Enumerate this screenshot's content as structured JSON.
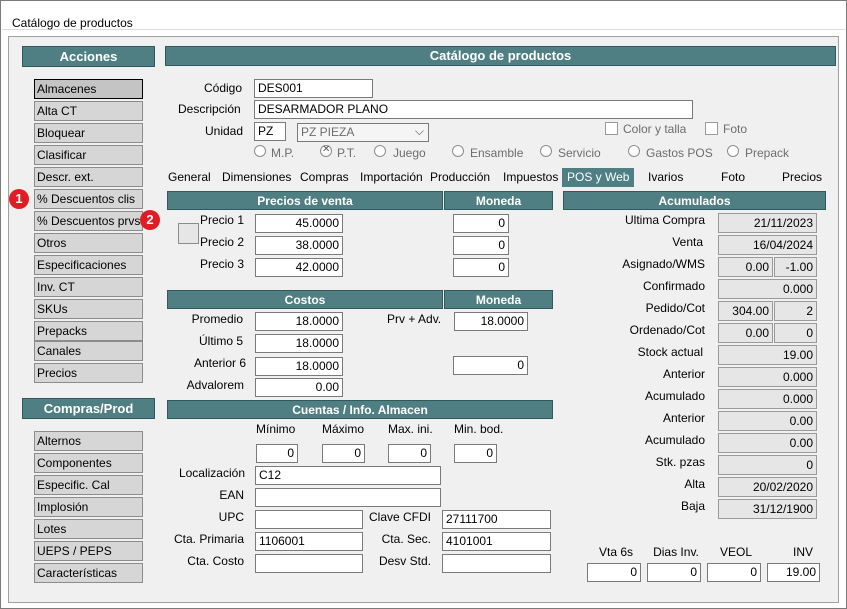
{
  "window": {
    "title": "Catálogo de productos"
  },
  "sidebar": {
    "acciones_title": "Acciones",
    "acciones": [
      "Almacenes",
      "Alta CT",
      "Bloquear",
      "Clasificar",
      "Descr. ext.",
      "% Descuentos clis",
      "% Descuentos prvs",
      "Otros",
      "Especificaciones",
      "Inv. CT",
      "SKUs",
      "Prepacks",
      "Canales",
      "Precios"
    ],
    "compras_title": "Compras/Prod",
    "compras": [
      "Alternos",
      "Componentes",
      "Especific. Cal",
      "Implosión",
      "Lotes",
      "UEPS / PEPS",
      "Características"
    ],
    "badges": [
      "1",
      "2"
    ]
  },
  "main": {
    "title": "Catálogo de productos",
    "codigo_label": "Código",
    "codigo": "DES001",
    "descripcion_label": "Descripción",
    "descripcion": "DESARMADOR PLANO",
    "unidad_label": "Unidad",
    "unidad": "PZ",
    "unidad_select": "PZ  PIEZA",
    "color_talla": "Color y talla",
    "foto": "Foto",
    "radios": [
      "M.P.",
      "P.T.",
      "Juego",
      "Ensamble",
      "Servicio",
      "Gastos POS",
      "Prepack"
    ],
    "radio_selected": "P.T."
  },
  "tabs": [
    "General",
    "Dimensiones",
    "Compras",
    "Importación",
    "Producción",
    "Impuestos",
    "POS y Web",
    "Ivarios",
    "Foto",
    "Precios"
  ],
  "active_tab": "POS y Web",
  "precios": {
    "title": "Precios de venta",
    "moneda": "Moneda",
    "rows": [
      {
        "label": "Precio 1",
        "value": "45.0000",
        "moneda": "0"
      },
      {
        "label": "Precio 2",
        "value": "38.0000",
        "moneda": "0"
      },
      {
        "label": "Precio 3",
        "value": "42.0000",
        "moneda": "0"
      }
    ]
  },
  "costos": {
    "title": "Costos",
    "moneda": "Moneda",
    "promedio_label": "Promedio",
    "promedio": "18.0000",
    "ultimo_label": "Último 5",
    "ultimo": "18.0000",
    "anterior_label": "Anterior 6",
    "anterior": "18.0000",
    "advalorem_label": "Advalorem",
    "advalorem": "0.00",
    "prv_label": "Prv + Adv.",
    "prv": "18.0000",
    "moneda_value": "0"
  },
  "cuentas": {
    "title": "Cuentas / Info. Almacen",
    "minimo_label": "Mínimo",
    "minimo": "0",
    "maximo_label": "Máximo",
    "maximo": "0",
    "maxini_label": "Max. ini.",
    "maxini": "0",
    "minbod_label": "Min. bod.",
    "minbod": "0",
    "localizacion_label": "Localización",
    "localizacion": "C12",
    "ean_label": "EAN",
    "ean": "",
    "upc_label": "UPC",
    "upc": "",
    "clave_label": "Clave CFDI",
    "clave": "27111700",
    "cta_primaria_label": "Cta. Primaria",
    "cta_primaria": "1106001",
    "cta_sec_label": "Cta. Sec.",
    "cta_sec": "4101001",
    "cta_costo_label": "Cta. Costo",
    "cta_costo": "",
    "desv_label": "Desv Std.",
    "desv": ""
  },
  "acumulados": {
    "title": "Acumulados",
    "ultima_compra_label": "Ultima  Compra",
    "ultima_compra": "21/11/2023",
    "venta_label": "Venta",
    "venta": "16/04/2024",
    "asignado_label": "Asignado/WMS",
    "asignado_a": "0.00",
    "asignado_b": "-1.00",
    "confirmado_label": "Confirmado",
    "confirmado": "0.000",
    "pedido_label": "Pedido/Cot",
    "pedido_a": "304.00",
    "pedido_b": "2",
    "ordenado_label": "Ordenado/Cot",
    "ordenado_a": "0.00",
    "ordenado_b": "0",
    "stock_label": "Stock actual",
    "stock": "19.00",
    "anterior1_label": "Anterior",
    "anterior1": "0.000",
    "acumulado1_label": "Acumulado",
    "acumulado1": "0.000",
    "anterior2_label": "Anterior",
    "anterior2": "0.00",
    "acumulado2_label": "Acumulado",
    "acumulado2": "0.00",
    "stk_label": "Stk. pzas",
    "stk": "0",
    "alta_label": "Alta",
    "alta": "20/02/2020",
    "baja_label": "Baja",
    "baja": "31/12/1900"
  },
  "footer": {
    "vta6s_label": "Vta 6s",
    "vta6s": "0",
    "dias_label": "Dias Inv.",
    "dias": "0",
    "veol_label": "VEOL",
    "veol": "0",
    "inv_label": "INV",
    "inv": "19.00"
  }
}
